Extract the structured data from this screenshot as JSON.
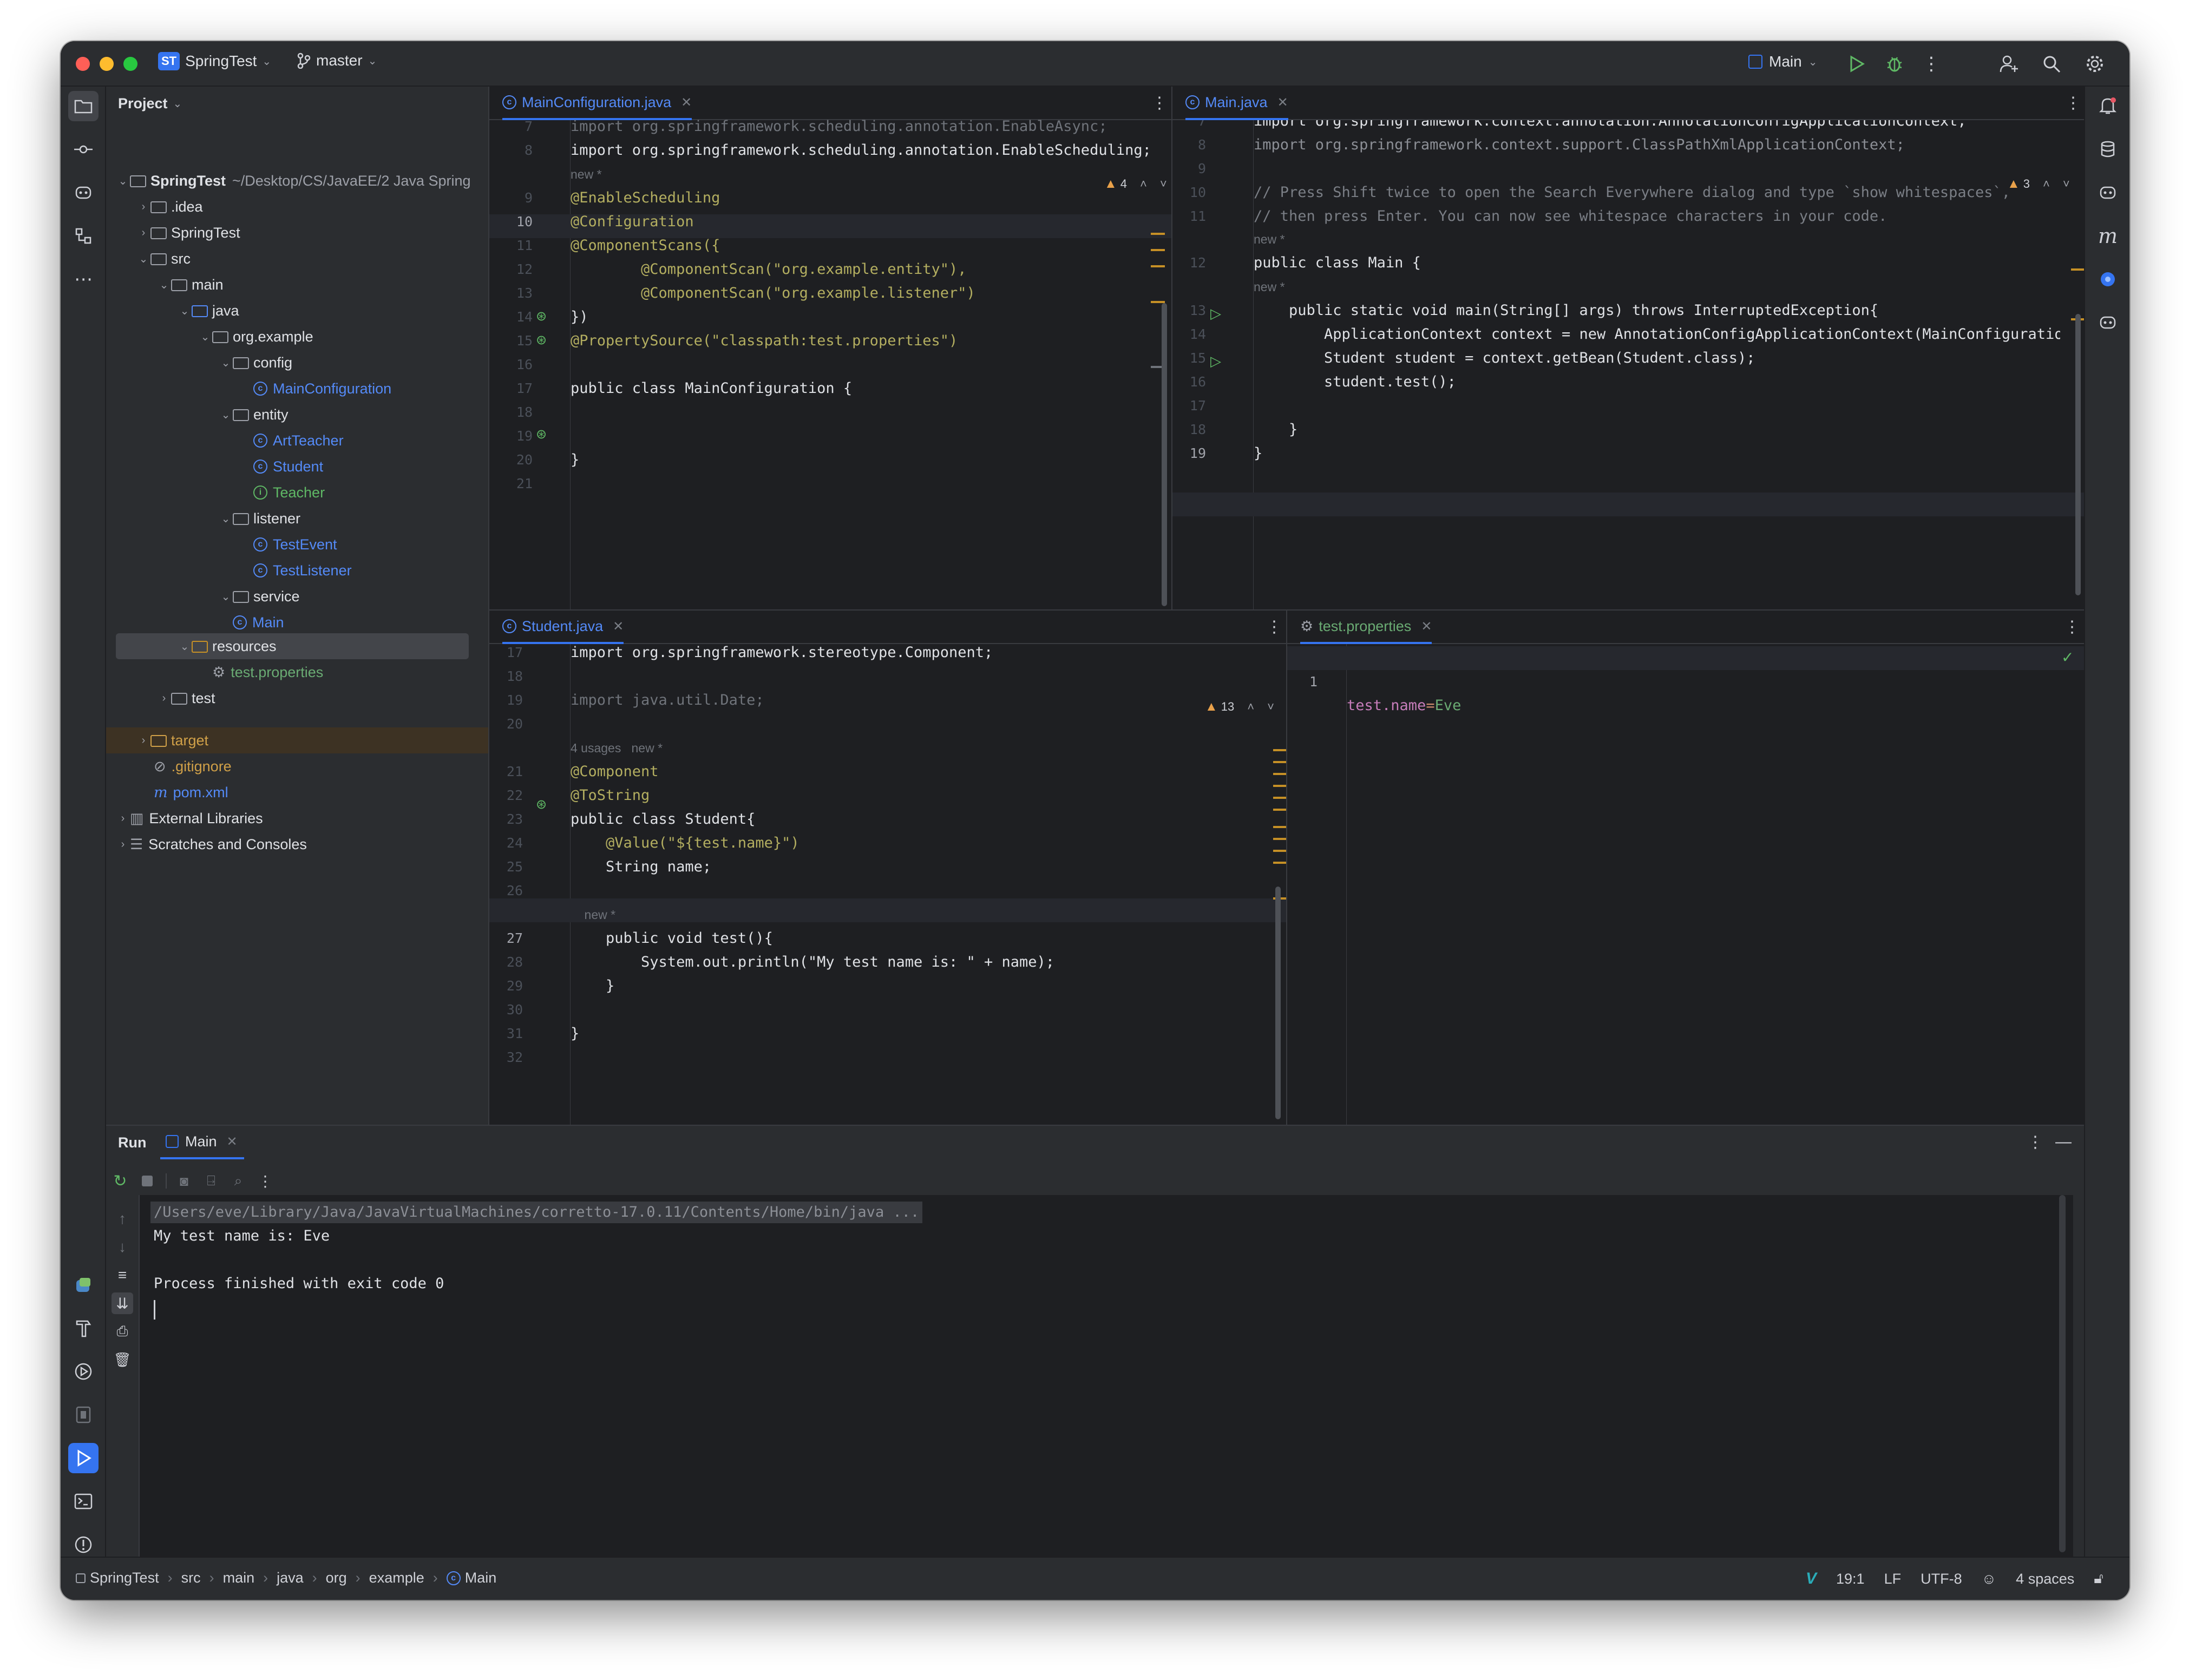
{
  "window": {
    "project_badge": "ST",
    "project_name": "SpringTest",
    "branch": "master",
    "run_config": "Main"
  },
  "project_panel": {
    "title": "Project",
    "root_name": "SpringTest",
    "root_path": "~/Desktop/CS/JavaEE/2 Java Spring",
    "items": [
      {
        "label": ".idea"
      },
      {
        "label": "SpringTest"
      },
      {
        "label": "src"
      },
      {
        "label": "main"
      },
      {
        "label": "java"
      },
      {
        "label": "org.example"
      },
      {
        "label": "config"
      },
      {
        "label": "MainConfiguration"
      },
      {
        "label": "entity"
      },
      {
        "label": "ArtTeacher"
      },
      {
        "label": "Student"
      },
      {
        "label": "Teacher"
      },
      {
        "label": "listener"
      },
      {
        "label": "TestEvent"
      },
      {
        "label": "TestListener"
      },
      {
        "label": "service"
      },
      {
        "label": "Main"
      },
      {
        "label": "resources"
      },
      {
        "label": "test.properties"
      },
      {
        "label": "test"
      },
      {
        "label": "target"
      },
      {
        "label": ".gitignore"
      },
      {
        "label": "pom.xml"
      },
      {
        "label": "External Libraries"
      },
      {
        "label": "Scratches and Consoles"
      }
    ]
  },
  "editors": {
    "main_configuration": {
      "tab": "MainConfiguration.java",
      "warnings": "4",
      "lines": [
        {
          "n": "7",
          "t": "import org.springframework.scheduling.annotation.EnableAsync;"
        },
        {
          "n": "8",
          "t": "import org.springframework.scheduling.annotation.EnableScheduling;"
        },
        {
          "n": "",
          "t": "new *"
        },
        {
          "n": "9",
          "t": "@EnableScheduling"
        },
        {
          "n": "10",
          "t": "@Configuration"
        },
        {
          "n": "11",
          "t": "@ComponentScans({"
        },
        {
          "n": "12",
          "t": "        @ComponentScan(\"org.example.entity\"),"
        },
        {
          "n": "13",
          "t": "        @ComponentScan(\"org.example.listener\")"
        },
        {
          "n": "14",
          "t": "})"
        },
        {
          "n": "15",
          "t": "@PropertySource(\"classpath:test.properties\")"
        },
        {
          "n": "16",
          "t": ""
        },
        {
          "n": "17",
          "t": "public class MainConfiguration {"
        },
        {
          "n": "18",
          "t": ""
        },
        {
          "n": "19",
          "t": ""
        },
        {
          "n": "20",
          "t": "}"
        },
        {
          "n": "21",
          "t": ""
        }
      ]
    },
    "main": {
      "tab": "Main.java",
      "warnings": "3",
      "lines": [
        {
          "n": "7",
          "t": "import org.springframework.context.annotation.AnnotationConfigApplicationContext;"
        },
        {
          "n": "8",
          "t": "import org.springframework.context.support.ClassPathXmlApplicationContext;"
        },
        {
          "n": "9",
          "t": ""
        },
        {
          "n": "10",
          "t": "// Press Shift twice to open the Search Everywhere dialog and type `show whitespaces`,"
        },
        {
          "n": "11",
          "t": "// then press Enter. You can now see whitespace characters in your code."
        },
        {
          "n": "",
          "t": "new *"
        },
        {
          "n": "12",
          "t": "public class Main {"
        },
        {
          "n": "",
          "t": "new *"
        },
        {
          "n": "13",
          "t": "    public static void main(String[] args) throws InterruptedException{"
        },
        {
          "n": "14",
          "t": "        ApplicationContext context = new AnnotationConfigApplicationContext(MainConfiguration.clas"
        },
        {
          "n": "15",
          "t": "        Student student = context.getBean(Student.class);"
        },
        {
          "n": "16",
          "t": "        student.test();"
        },
        {
          "n": "17",
          "t": ""
        },
        {
          "n": "18",
          "t": "    }"
        },
        {
          "n": "19",
          "t": "}"
        }
      ]
    },
    "student": {
      "tab": "Student.java",
      "warnings": "13",
      "lines": [
        {
          "n": "17",
          "t": "import org.springframework.stereotype.Component;"
        },
        {
          "n": "18",
          "t": ""
        },
        {
          "n": "19",
          "t": "import java.util.Date;"
        },
        {
          "n": "20",
          "t": ""
        },
        {
          "n": "",
          "t": "4 usages   new *"
        },
        {
          "n": "21",
          "t": "@Component"
        },
        {
          "n": "22",
          "t": "@ToString"
        },
        {
          "n": "23",
          "t": "public class Student{"
        },
        {
          "n": "24",
          "t": "    @Value(\"${test.name}\")"
        },
        {
          "n": "25",
          "t": "    String name;"
        },
        {
          "n": "26",
          "t": ""
        },
        {
          "n": "",
          "t": "    new *"
        },
        {
          "n": "27",
          "t": "    public void test(){"
        },
        {
          "n": "28",
          "t": "        System.out.println(\"My test name is: \" + name);"
        },
        {
          "n": "29",
          "t": "    }"
        },
        {
          "n": "30",
          "t": ""
        },
        {
          "n": "31",
          "t": "}"
        },
        {
          "n": "32",
          "t": ""
        }
      ]
    },
    "properties": {
      "tab": "test.properties",
      "lines": [
        {
          "n": "1",
          "key": "test.name",
          "eq": "=",
          "val": "Eve"
        }
      ]
    }
  },
  "run_panel": {
    "title": "Run",
    "tab": "Main",
    "output": [
      "/Users/eve/Library/Java/JavaVirtualMachines/corretto-17.0.11/Contents/Home/bin/java ...",
      "My test name is: Eve",
      "",
      "Process finished with exit code 0"
    ]
  },
  "status_bar": {
    "breadcrumbs": [
      "SpringTest",
      "src",
      "main",
      "java",
      "org",
      "example",
      "Main"
    ],
    "position": "19:1",
    "line_sep": "LF",
    "encoding": "UTF-8",
    "indent": "4 spaces"
  },
  "colors": {
    "accent": "#3574f0",
    "keyword": "#cf8e6d",
    "string": "#6aab73",
    "annotation": "#b3ae60",
    "run_green": "#5fb865"
  }
}
